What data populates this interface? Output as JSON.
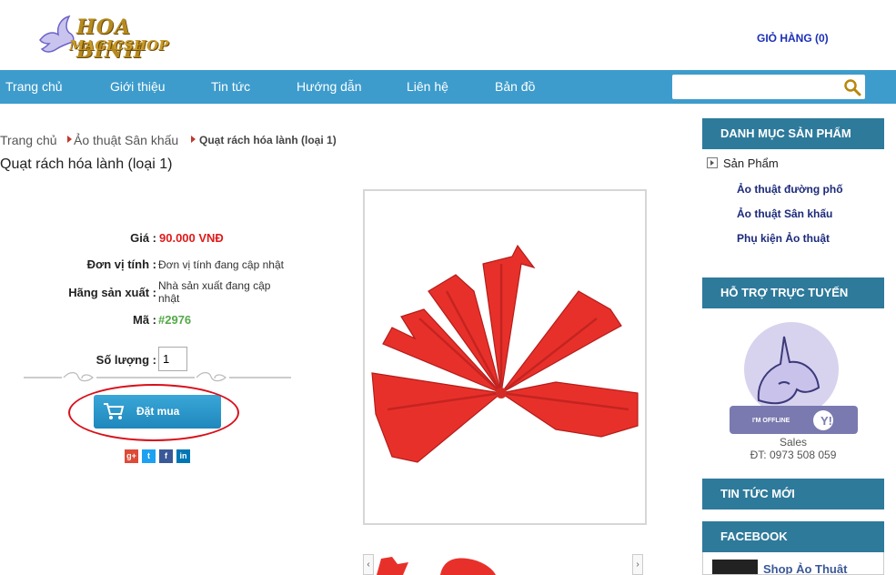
{
  "header": {
    "logo_line1": "HOA BINH",
    "logo_line2": "MAGICSHOP",
    "cart": "GIỎ HÀNG (0)"
  },
  "nav": {
    "items": [
      "Trang chủ",
      "Giới thiệu",
      "Tin tức",
      "Hướng dẫn",
      "Liên hệ",
      "Bản đồ"
    ],
    "search_placeholder": ""
  },
  "breadcrumb": {
    "home": "Trang chủ",
    "category": "Ảo thuật Sân khấu",
    "current": "Quạt rách hóa lành (loại 1)"
  },
  "product": {
    "title": "Quạt rách hóa lành (loại 1)",
    "price_label": "Giá :",
    "price": "90.000 VNĐ",
    "unit_label": "Đơn vị tính :",
    "unit": "Đơn vị tính đang cập nhật",
    "brand_label": "Hãng sản xuất :",
    "brand": "Nhà sản xuất đang cập nhật",
    "code_label": "Mã :",
    "code": "#2976",
    "qty_label": "Số lượng :",
    "qty": "1",
    "buy_button": "Đặt mua"
  },
  "social": {
    "colors": {
      "gplus": "#dd4b39",
      "twitter": "#1da1f2",
      "facebook": "#3b5998",
      "linkedin": "#0077b5"
    }
  },
  "sidebar": {
    "categories_title": "DANH MỤC SẢN PHẨM",
    "root": "Sản Phẩm",
    "items": [
      "Ảo thuật đường phố",
      "Ảo thuật Sân khấu",
      "Phụ kiện Ảo thuật"
    ],
    "support_title": "HỖ TRỢ TRỰC TUYẾN",
    "yahoo_status": "I'M OFFLINE",
    "sales": "Sales",
    "phone": "ĐT: 0973 508 059",
    "news_title": "TIN TỨC MỚI",
    "facebook_title": "FACEBOOK",
    "facebook_page": "Shop Ảo Thuật"
  },
  "colors": {
    "nav": "#3d9ccc",
    "sidebar_head": "#2e7a9b",
    "price": "#e01b1b",
    "code": "#55a84a"
  }
}
